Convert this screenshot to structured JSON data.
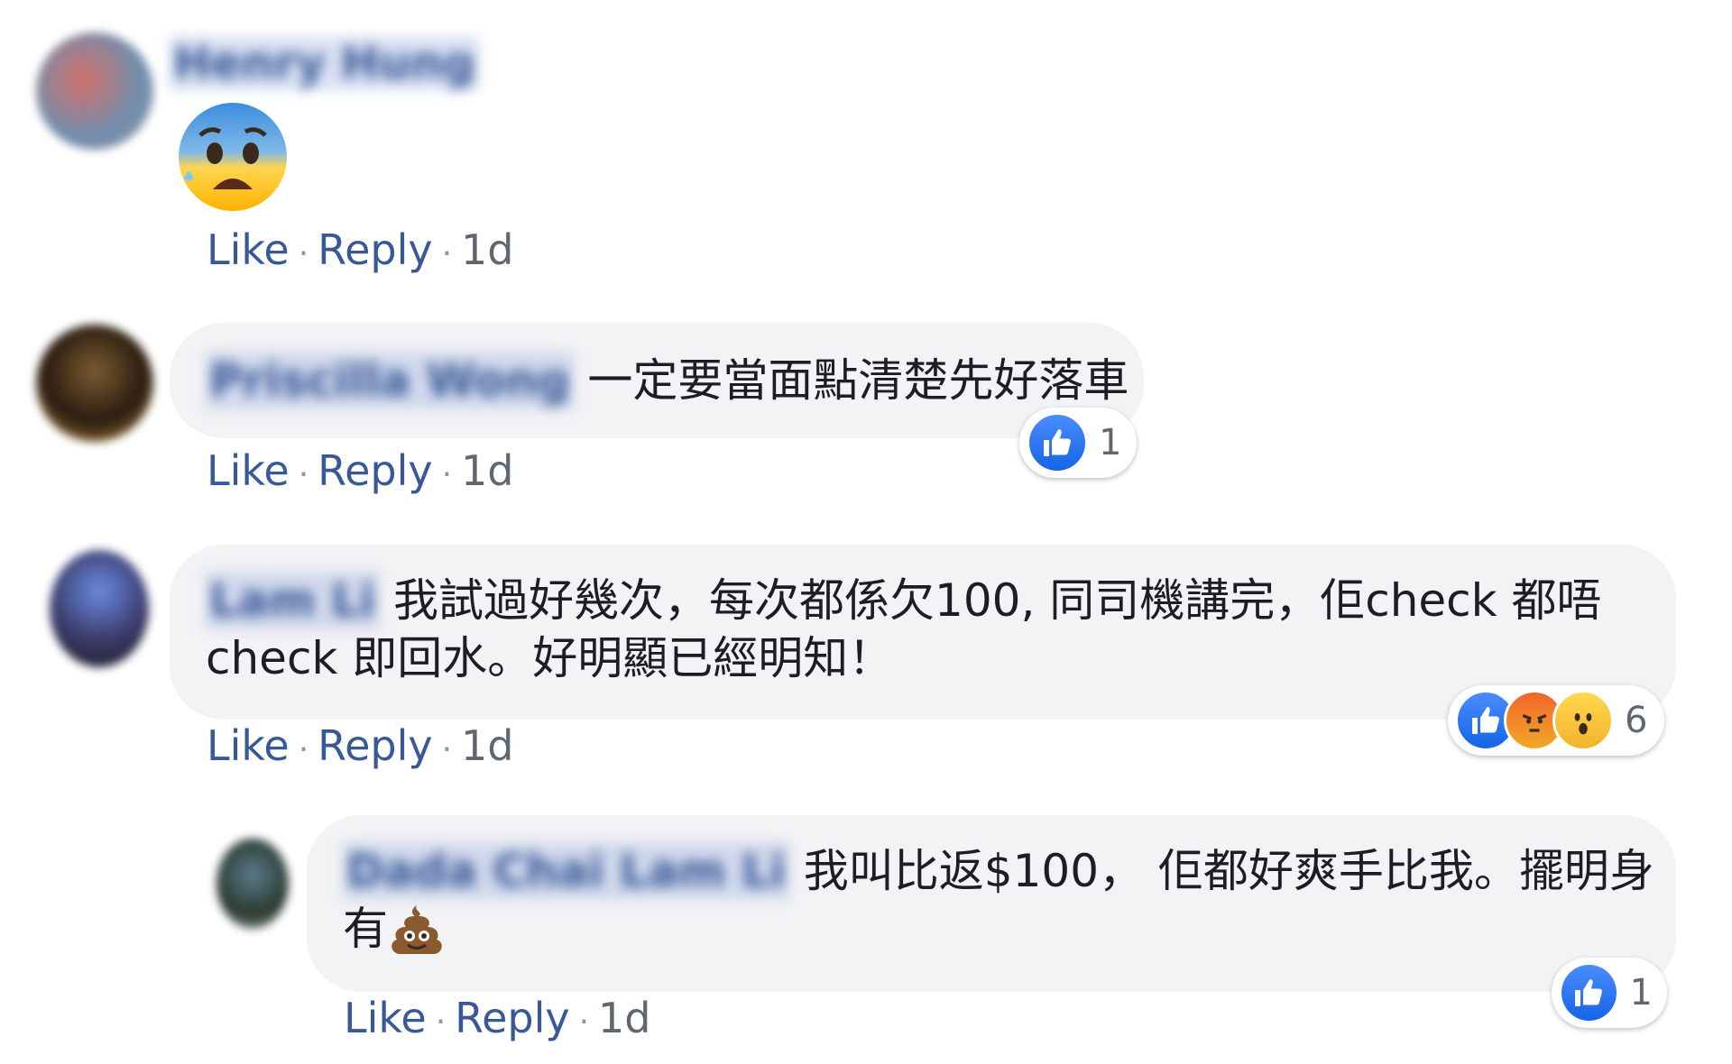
{
  "comments": [
    {
      "author": "Henry Hung",
      "emoji": "anxious-face-with-sweat",
      "actions": {
        "like": "Like",
        "reply": "Reply",
        "time": "1d"
      }
    },
    {
      "author": "Priscilla Wong",
      "text": "一定要當面點清楚先好落車",
      "reaction_count": "1",
      "actions": {
        "like": "Like",
        "reply": "Reply",
        "time": "1d"
      }
    },
    {
      "author": "Lam Li",
      "text_line1": "我試過好幾次，每次都係欠100, 同司機講完，佢check 都唔",
      "text_line2": "check 即回水。好明顯已經明知！",
      "reaction_count": "6",
      "actions": {
        "like": "Like",
        "reply": "Reply",
        "time": "1d"
      }
    },
    {
      "author": "Dada Chai Lam Li",
      "text_line1": "我叫比返$100， 佢都好爽手比我。擺明身",
      "text_line2": "有",
      "reaction_count": "1",
      "actions": {
        "like": "Like",
        "reply": "Reply",
        "time": "1d"
      }
    }
  ],
  "colors": {
    "link": "#385898",
    "bubble": "#f2f3f5",
    "like_blue": "#1877f2"
  },
  "icons": [
    "like-reaction-icon",
    "angry-reaction-icon",
    "wow-reaction-icon",
    "poop-emoji-icon",
    "anxious-face-emoji-icon"
  ]
}
